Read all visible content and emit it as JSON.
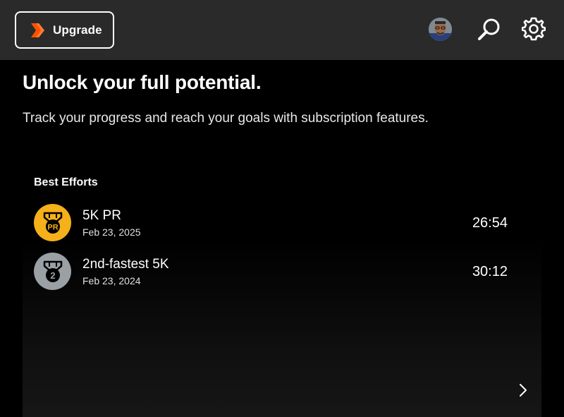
{
  "header": {
    "upgrade_label": "Upgrade",
    "brand_color": "#fc5200"
  },
  "hero": {
    "title": "Unlock your full potential.",
    "subtitle": "Track your progress and reach your goals with subscription features."
  },
  "best_efforts": {
    "title": "Best Efforts",
    "items": [
      {
        "name": "5K PR",
        "date": "Feb 23, 2025",
        "time": "26:54",
        "medal": "PR",
        "medal_color": "#f5b01a"
      },
      {
        "name": "2nd-fastest 5K",
        "date": "Feb 23, 2024",
        "time": "30:12",
        "medal": "2",
        "medal_color": "#9aa0a4"
      }
    ]
  }
}
